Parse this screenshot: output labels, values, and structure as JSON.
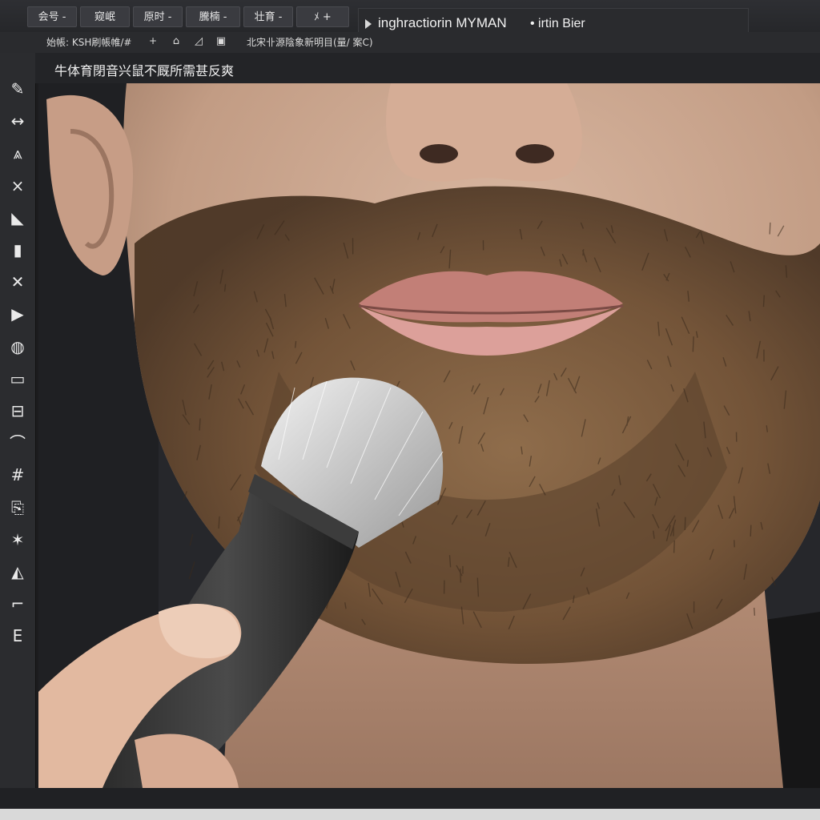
{
  "menubar": {
    "items": [
      {
        "label": "会号 -"
      },
      {
        "label": "窥岷"
      },
      {
        "label": "原时 -"
      },
      {
        "label": "騰楠 -"
      },
      {
        "label": "壮育 -"
      },
      {
        "label": "ﾒ  +"
      }
    ],
    "document_tab": {
      "title": "inghractiorin MYMAN",
      "subtitle": "• irtin Bier"
    }
  },
  "optionsbar": {
    "preset_label": "始帳: KSH刷帳帷/#",
    "plus": "+",
    "status_text": "北宋卝源陰象新明目(量/ 案C)"
  },
  "canvas_header": {
    "label": "牛体育閉音兴鼠不厩所需甚反爽"
  },
  "tools": [
    {
      "name": "brush-tool-icon",
      "glyph": "✎"
    },
    {
      "name": "move-tool-icon",
      "glyph": "↔"
    },
    {
      "name": "pen-tool-icon",
      "glyph": "⩓"
    },
    {
      "name": "close-tool-icon",
      "glyph": "×"
    },
    {
      "name": "select-tool-icon",
      "glyph": "◣"
    },
    {
      "name": "lock-tool-icon",
      "glyph": "▮"
    },
    {
      "name": "crop-tool-icon",
      "glyph": "✕"
    },
    {
      "name": "play-tool-icon",
      "glyph": "▶"
    },
    {
      "name": "globe-tool-icon",
      "glyph": "◍"
    },
    {
      "name": "swatch-tool-icon",
      "glyph": "▭"
    },
    {
      "name": "frame-tool-icon",
      "glyph": "⊟"
    },
    {
      "name": "lasso-tool-icon",
      "glyph": "⌒"
    },
    {
      "name": "hash-tool-icon",
      "glyph": "#"
    },
    {
      "name": "clipboard-tool-icon",
      "glyph": "⎘"
    },
    {
      "name": "star-tool-icon",
      "glyph": "✶"
    },
    {
      "name": "shape-tool-icon",
      "glyph": "◭"
    },
    {
      "name": "bracket-tool-icon",
      "glyph": "⌐"
    },
    {
      "name": "text-tool-icon",
      "glyph": "E"
    }
  ],
  "colors": {
    "ui_dark": "#1c1c1e",
    "panel": "#2b2c2f",
    "beard": "#7a5a3a",
    "skin": "#c9a58d"
  }
}
